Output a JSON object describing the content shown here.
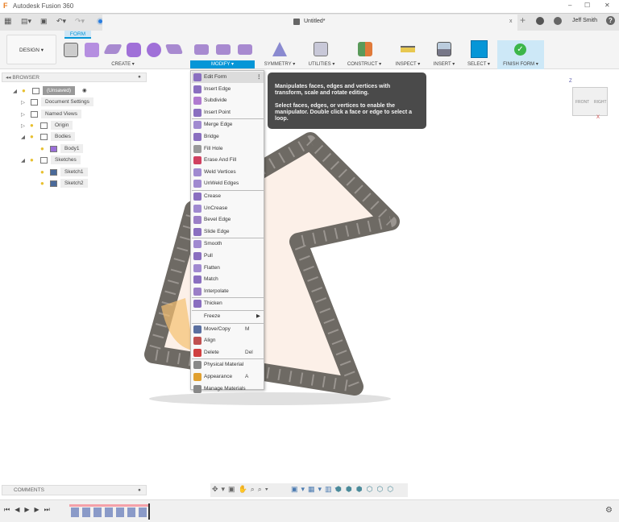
{
  "window": {
    "title": "Autodesk Fusion 360",
    "min": "–",
    "max": "☐",
    "close": "✕"
  },
  "tab": {
    "title": "Untitled*",
    "close": "x",
    "user": "Jeff Smith",
    "help": "?"
  },
  "ribbon": {
    "workspace": "DESIGN ▾",
    "active_tab": "FORM",
    "groups": [
      "CREATE ▾",
      "MODIFY ▾",
      "SYMMETRY ▾",
      "UTILITIES ▾",
      "CONSTRUCT ▾",
      "INSPECT ▾",
      "INSERT ▾",
      "SELECT ▾",
      "FINISH FORM ▾"
    ]
  },
  "browser": {
    "title": "BROWSER",
    "items": [
      {
        "label": "(Unsaved)",
        "depth": 0
      },
      {
        "label": "Document Settings",
        "depth": 1
      },
      {
        "label": "Named Views",
        "depth": 1
      },
      {
        "label": "Origin",
        "depth": 1
      },
      {
        "label": "Bodies",
        "depth": 1
      },
      {
        "label": "Body1",
        "depth": 2
      },
      {
        "label": "Sketches",
        "depth": 1
      },
      {
        "label": "Sketch1",
        "depth": 2
      },
      {
        "label": "Sketch2",
        "depth": 2
      }
    ]
  },
  "menu": {
    "more": "⋮",
    "groups": [
      [
        {
          "label": "Edit Form",
          "color": "#8a6fc0"
        },
        {
          "label": "Insert Edge",
          "color": "#8a6fc0"
        },
        {
          "label": "Subdivide",
          "color": "#b07ad0"
        },
        {
          "label": "Insert Point",
          "color": "#8a6fc0"
        }
      ],
      [
        {
          "label": "Merge Edge",
          "color": "#a08ad0"
        },
        {
          "label": "Bridge",
          "color": "#8a6fc0"
        },
        {
          "label": "Fill Hole",
          "color": "#999"
        },
        {
          "label": "Erase And Fill",
          "color": "#d04060"
        },
        {
          "label": "Weld Vertices",
          "color": "#a08ad0"
        },
        {
          "label": "UnWeld Edges",
          "color": "#a08ad0"
        }
      ],
      [
        {
          "label": "Crease",
          "color": "#8a6fc0"
        },
        {
          "label": "UnCrease",
          "color": "#a08ad0"
        },
        {
          "label": "Bevel Edge",
          "color": "#9b7fc7"
        },
        {
          "label": "Slide Edge",
          "color": "#8a6fc0"
        }
      ],
      [
        {
          "label": "Smooth",
          "color": "#a08ad0"
        },
        {
          "label": "Pull",
          "color": "#8a6fc0"
        },
        {
          "label": "Flatten",
          "color": "#a08ad0"
        },
        {
          "label": "Match",
          "color": "#8a6fc0"
        },
        {
          "label": "Interpolate",
          "color": "#9b7fc7"
        }
      ],
      [
        {
          "label": "Thicken",
          "color": "#8a6fc0"
        }
      ],
      [
        {
          "label": "Freeze",
          "color": "",
          "arrow": "▶"
        }
      ],
      [
        {
          "label": "Move/Copy",
          "color": "#5a6fa0",
          "shortcut": "M"
        },
        {
          "label": "Align",
          "color": "#c05050"
        },
        {
          "label": "Delete",
          "color": "#d04040",
          "shortcut": "Del"
        }
      ],
      [
        {
          "label": "Physical Material",
          "color": "#888"
        },
        {
          "label": "Appearance",
          "color": "#e0a030",
          "shortcut": "A"
        },
        {
          "label": "Manage Materials",
          "color": "#888"
        }
      ]
    ]
  },
  "tooltip": {
    "p1": "Manipulates faces, edges and vertices with transform, scale and rotate editing.",
    "p2": "Select faces, edges, or vertices to enable the manipulator. Double click a face or edge to select a loop."
  },
  "viewcube": {
    "front": "FRONT",
    "right": "RIGHT",
    "z": "Z",
    "x": "X"
  },
  "comments": {
    "title": "COMMENTS"
  },
  "timeline": {
    "controls": [
      "⏮",
      "◀",
      "▶",
      "▶",
      "⏭"
    ]
  },
  "colors": {
    "accent": "#0696d7",
    "modify_bg": "#0696d7",
    "finish_bg": "#cde8f7",
    "finish_icon": "#3cb64a"
  }
}
